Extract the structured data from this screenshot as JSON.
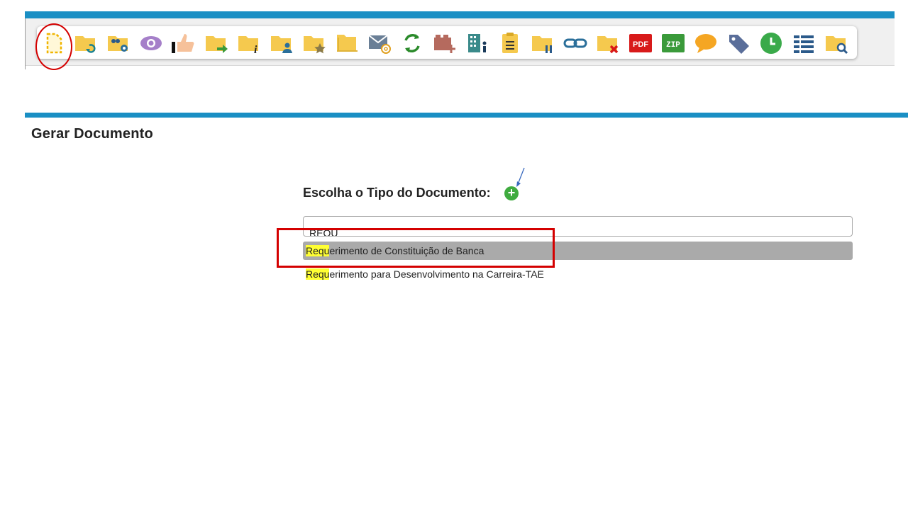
{
  "toolbar": {
    "icons": [
      "new-document-icon",
      "folder-sync-icon",
      "folder-people-settings-icon",
      "eye-icon",
      "thumbs-up-icon",
      "folder-forward-icon",
      "folder-info-icon",
      "folder-user-icon",
      "folder-star-icon",
      "folder-open-icon",
      "mail-at-icon",
      "sync-icon",
      "briefcase-add-icon",
      "building-person-icon",
      "clipboard-icon",
      "folder-pause-icon",
      "link-icon",
      "folder-delete-icon",
      "pdf-icon",
      "zip-icon",
      "comment-icon",
      "tag-icon",
      "clock-icon",
      "list-icon",
      "folder-search-icon"
    ],
    "pdf_label": "PDF",
    "zip_label": "ZIP"
  },
  "page": {
    "title": "Gerar Documento"
  },
  "form": {
    "choose_label": "Escolha o Tipo do Documento:",
    "add_symbol": "+",
    "search_value": "REQU",
    "results": [
      {
        "match": "Requ",
        "rest": "erimento de Constituição de Banca",
        "selected": true
      },
      {
        "match": "Requ",
        "rest": "erimento para Desenvolvimento na Carreira-TAE",
        "selected": false
      }
    ]
  },
  "colors": {
    "accent": "#1a8fc4",
    "annotation": "#d40000",
    "folder": "#f5c94e",
    "highlight": "#ffff33"
  }
}
